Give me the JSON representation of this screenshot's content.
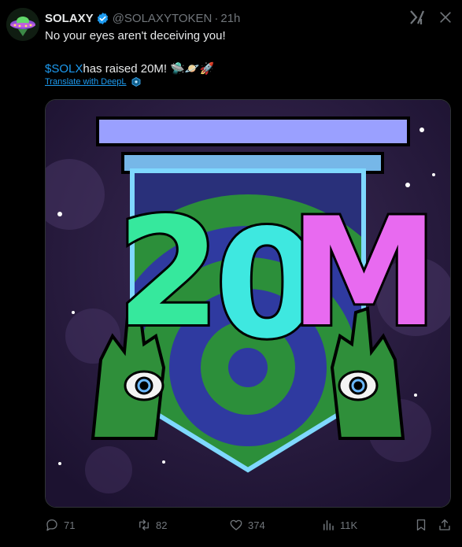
{
  "tweet": {
    "author_name": "SOLAXY",
    "handle": "@SOLAXYTOKEN",
    "separator": "·",
    "time": "21h",
    "line1": "No your eyes aren't deceiving you!",
    "cashtag": "$SOLX",
    "line2_rest": " has raised 20M!",
    "emojis": "🛸🪐🚀",
    "translate_label": "Translate with DeepL",
    "image_text": "20M"
  },
  "actions": {
    "replies": "71",
    "reposts": "82",
    "likes": "374",
    "views": "11K"
  },
  "colors": {
    "accent": "#1d9bf0",
    "muted": "#71767b",
    "text": "#e7e9ea"
  }
}
